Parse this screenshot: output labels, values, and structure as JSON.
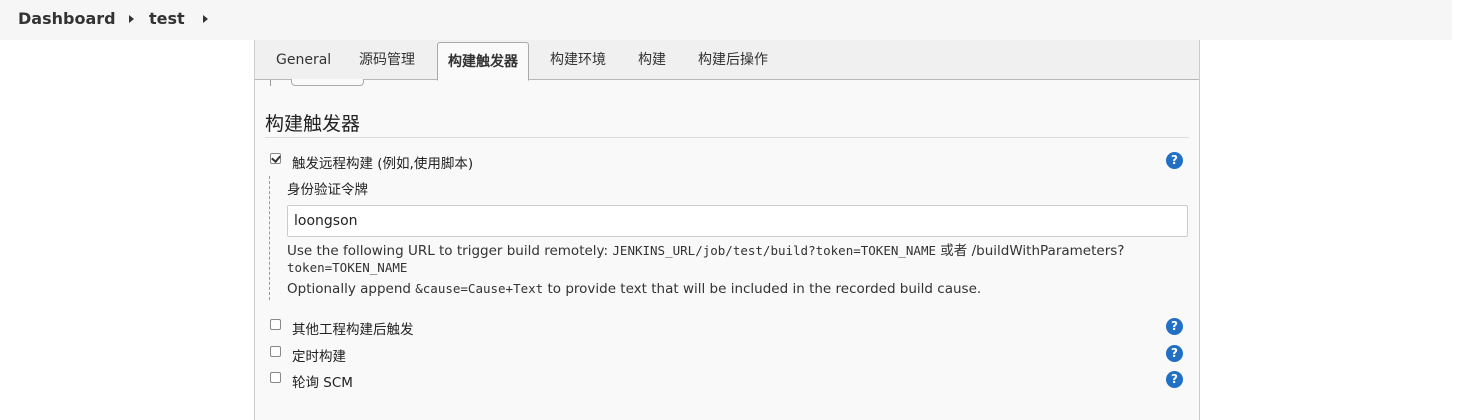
{
  "breadcrumb": {
    "items": [
      {
        "label": "Dashboard"
      },
      {
        "label": "test"
      }
    ]
  },
  "tabs": [
    {
      "label": "General",
      "active": false
    },
    {
      "label": "源码管理",
      "active": false
    },
    {
      "label": "构建触发器",
      "active": true
    },
    {
      "label": "构建环境",
      "active": false
    },
    {
      "label": "构建",
      "active": false
    },
    {
      "label": "构建后操作",
      "active": false
    }
  ],
  "section": {
    "title": "构建触发器"
  },
  "triggers": [
    {
      "label": "触发远程构建 (例如,使用脚本)",
      "checked": true,
      "help": "?"
    },
    {
      "label": "其他工程构建后触发",
      "checked": false,
      "help": "?"
    },
    {
      "label": "定时构建",
      "checked": false,
      "help": "?"
    },
    {
      "label": "轮询 SCM",
      "checked": false,
      "help": "?"
    }
  ],
  "remote": {
    "token_label": "身份验证令牌",
    "token_value": "loongson",
    "line1_prefix": "Use the following URL to trigger build remotely: ",
    "line1_code": "JENKINS_URL/job/test/build?token=TOKEN_NAME",
    "line1_middle": " 或者 ",
    "line1_code2": "/buildWithParameters?",
    "line2_code": "token=TOKEN_NAME",
    "line3_prefix": "Optionally append ",
    "line3_code": "&cause=Cause+Text",
    "line3_suffix": " to provide text that will be included in the recorded build cause."
  },
  "colors": {
    "help_icon": "#2170c4",
    "tabbar_bg": "#f0f0f0",
    "panel_bg": "#f9f9f9"
  }
}
